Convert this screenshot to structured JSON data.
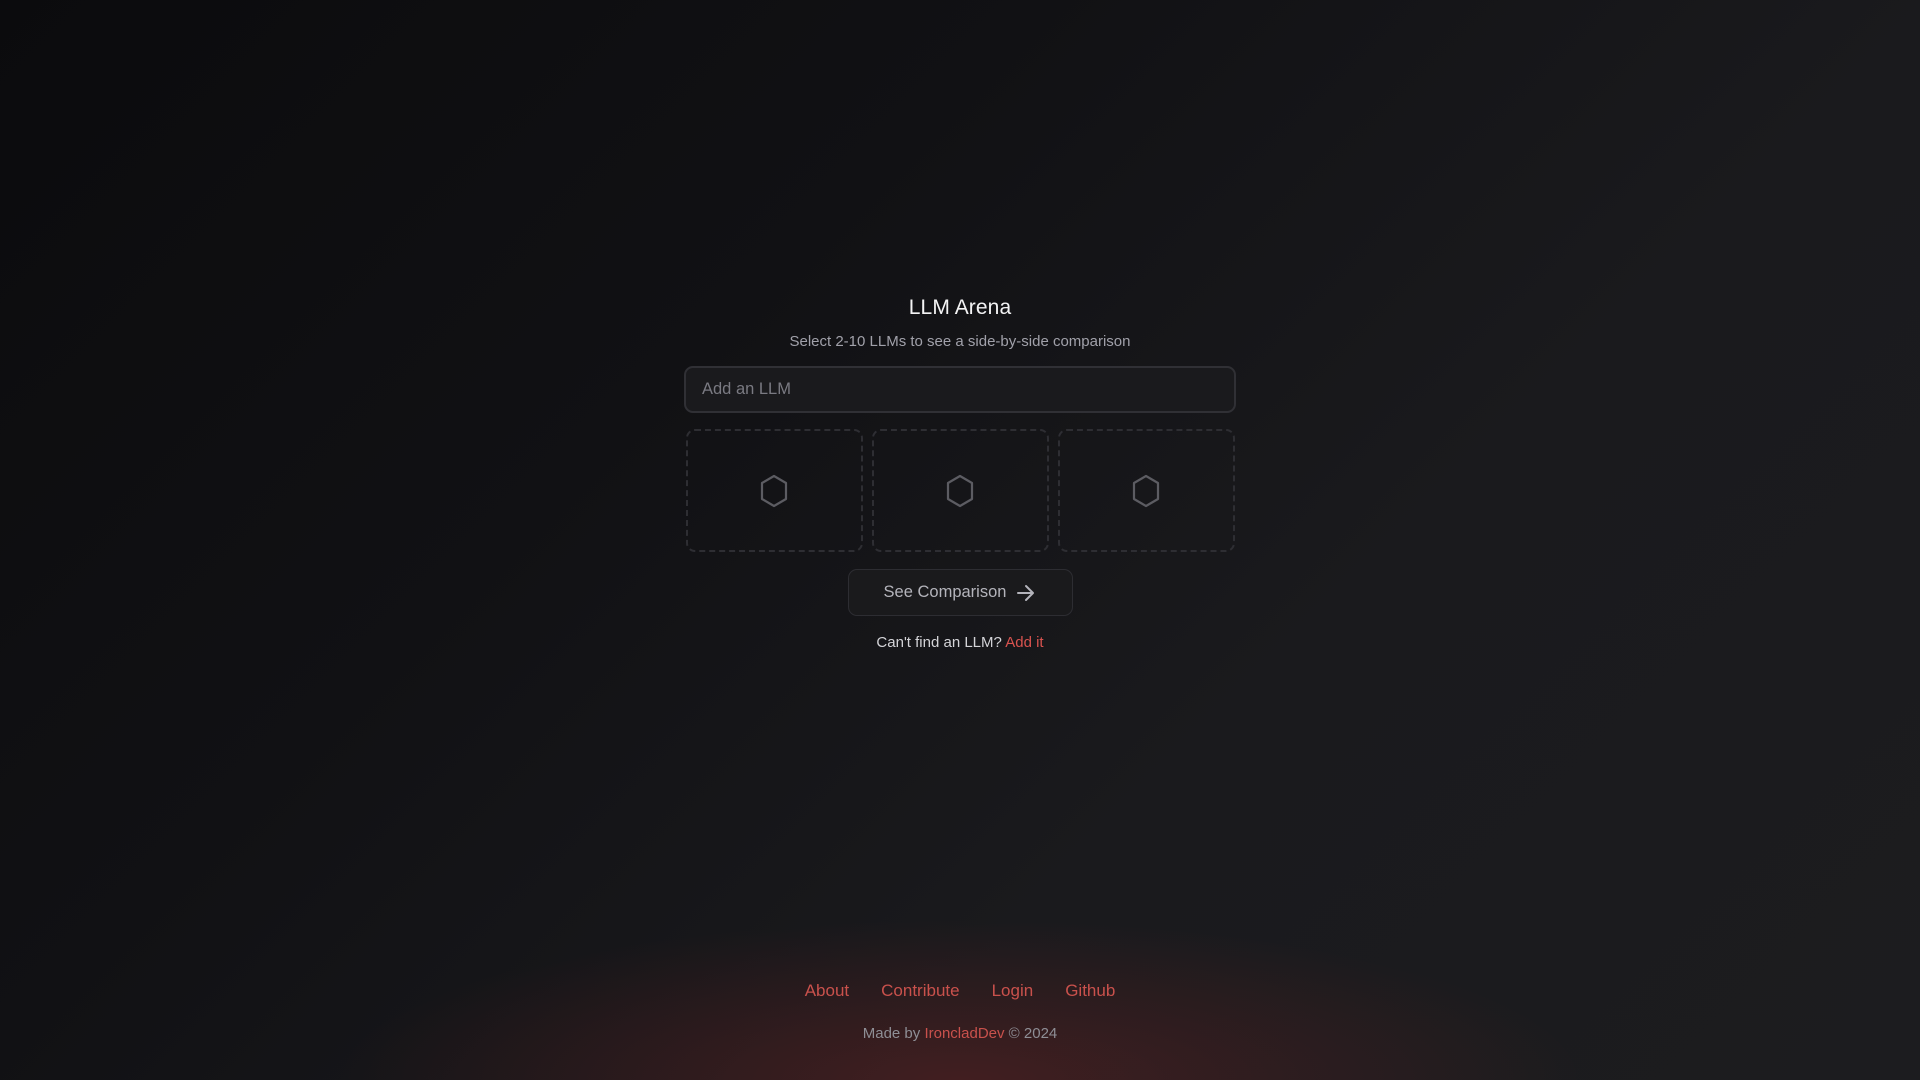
{
  "app": {
    "title": "LLM Arena",
    "subtitle": "Select 2-10 LLMs to see a side-by-side comparison"
  },
  "search": {
    "placeholder": "Add an LLM",
    "value": ""
  },
  "slots": [
    {
      "icon": "hexagon-icon"
    },
    {
      "icon": "hexagon-icon"
    },
    {
      "icon": "hexagon-icon"
    }
  ],
  "compare_button": {
    "label": "See Comparison",
    "icon": "arrow-right-icon"
  },
  "cant_find": {
    "text": "Can't find an LLM?",
    "link_label": "Add it"
  },
  "footer": {
    "links": [
      "About",
      "Contribute",
      "Login",
      "Github"
    ],
    "credit_prefix": "Made by",
    "credit_author": "IroncladDev",
    "credit_suffix": "© 2024"
  },
  "colors": {
    "accent": "#d9534f",
    "background_dark": "#0b0b0d",
    "surface": "#1a1a1d"
  }
}
